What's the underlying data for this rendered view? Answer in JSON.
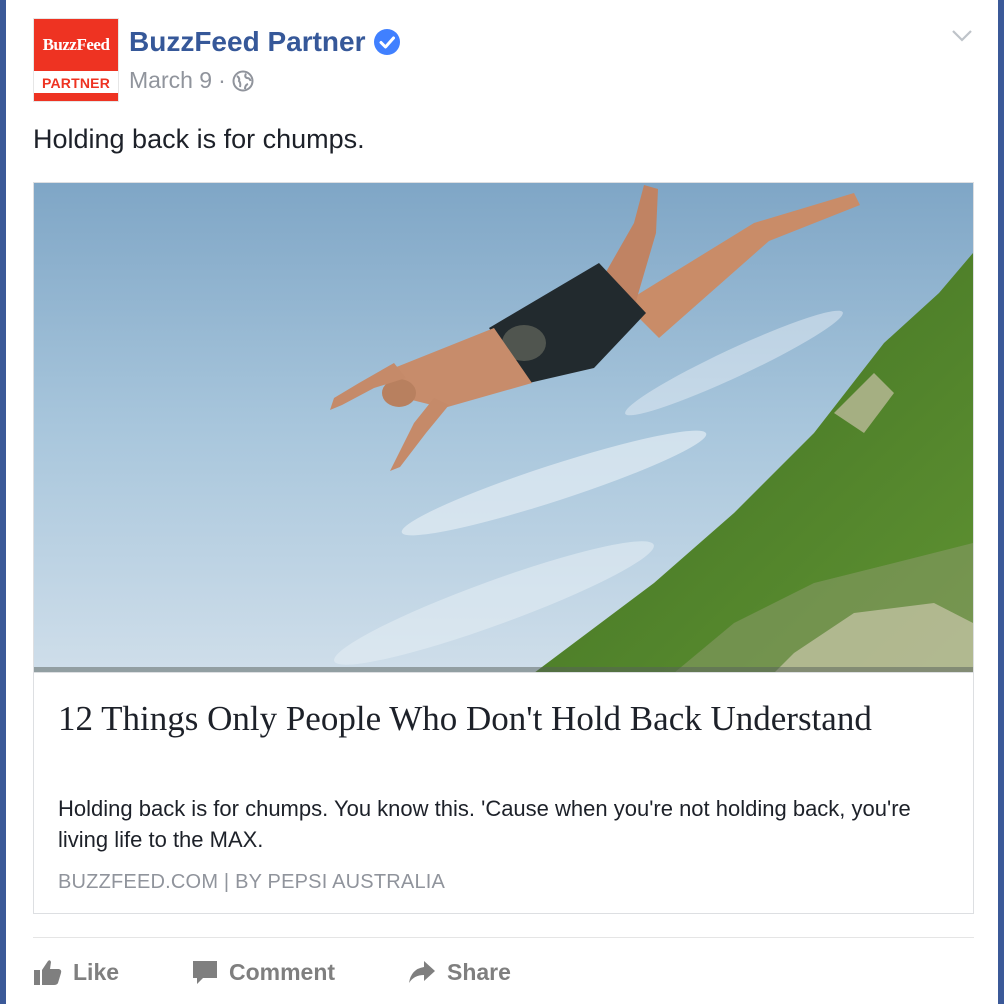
{
  "post": {
    "avatar": {
      "top_text": "BuzzFeed",
      "bottom_text": "PARTNER"
    },
    "page_name": "BuzzFeed Partner",
    "date": "March 9",
    "separator": "·",
    "message": "Holding back is for chumps."
  },
  "link": {
    "title": "12 Things Only People Who Don't Hold Back Understand",
    "description": "Holding back is for chumps. You know this. 'Cause when you're not holding back, you're living life to the MAX.",
    "source": "BUZZFEED.COM | BY PEPSI AUSTRALIA"
  },
  "actions": {
    "like": "Like",
    "comment": "Comment",
    "share": "Share"
  },
  "colors": {
    "page_bg": "#3b5998",
    "link_blue": "#365899",
    "meta_gray": "#90949c",
    "brand_red": "#ee3322",
    "verified_blue": "#4080ff"
  },
  "icons": [
    "verified-icon",
    "globe-icon",
    "chevron-down-icon",
    "like-icon",
    "comment-icon",
    "share-icon"
  ]
}
